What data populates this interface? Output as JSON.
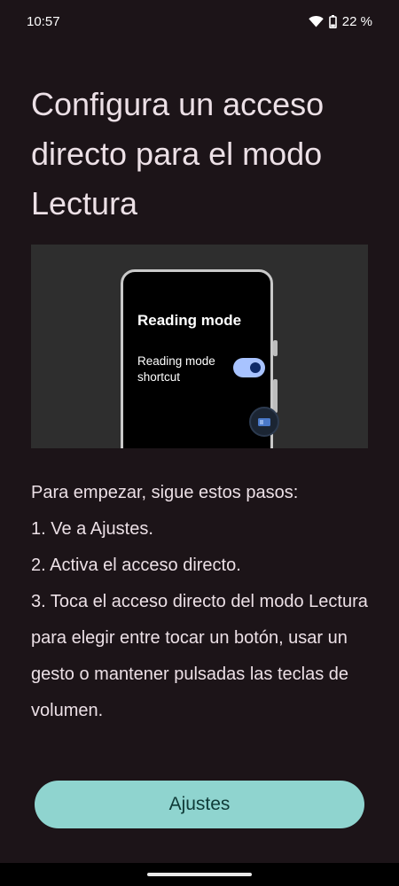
{
  "status_bar": {
    "time": "10:57",
    "battery": "22 %",
    "icons": [
      "wifi-icon",
      "battery-icon"
    ]
  },
  "page": {
    "title": "Configura un acceso directo para el modo Lectura"
  },
  "illustration": {
    "phone_title": "Reading mode",
    "phone_toggle_label": "Reading mode shortcut",
    "toggle_on": true
  },
  "steps": {
    "intro": "Para empezar, sigue estos pasos:",
    "items": [
      "1. Ve a Ajustes.",
      "2. Activa el acceso directo.",
      "3. Toca el acceso directo del modo Lectura para elegir entre tocar un botón, usar un gesto o mantener pulsadas las teclas de volumen."
    ]
  },
  "actions": {
    "settings_label": "Ajustes"
  },
  "colors": {
    "background": "#1c1418",
    "button": "#8fd4cf",
    "toggle": "#a8c3ff"
  }
}
